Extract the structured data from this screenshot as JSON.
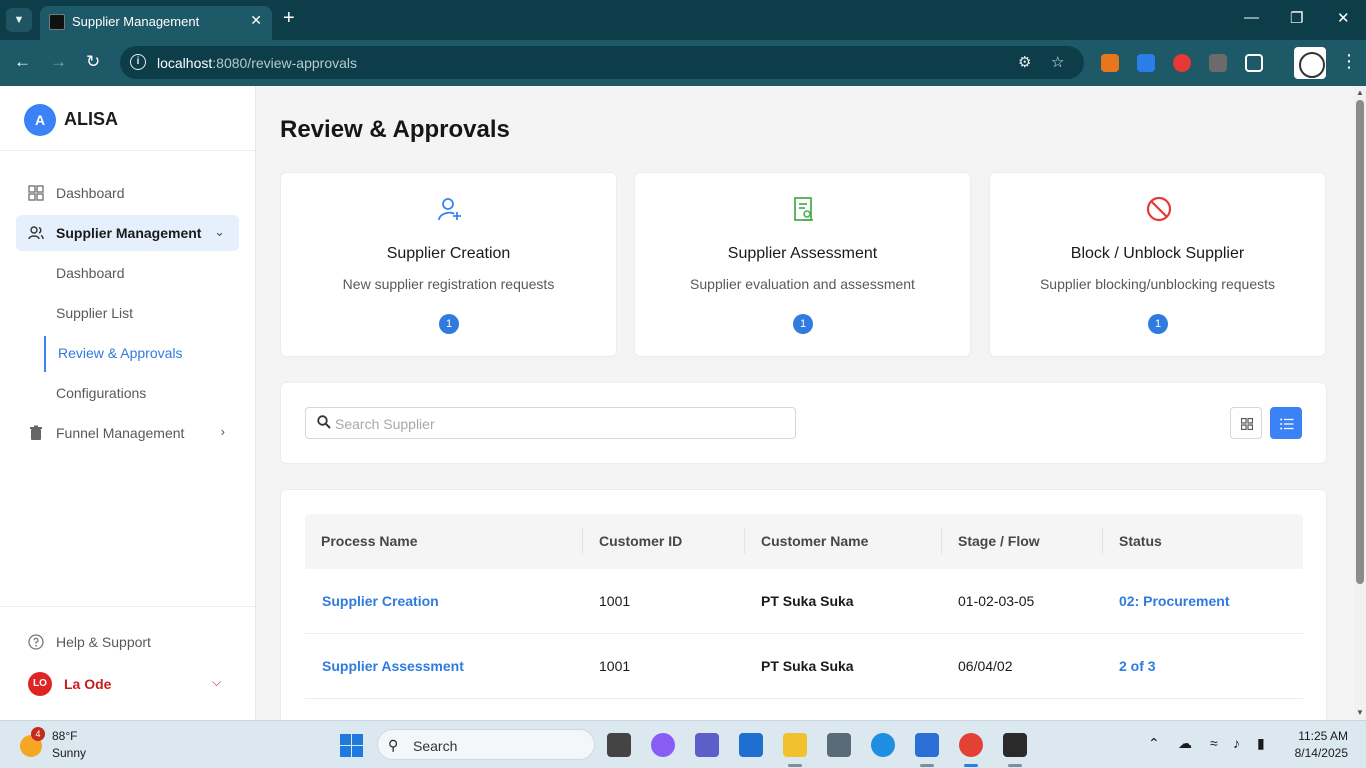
{
  "browser": {
    "tab_title": "Supplier Management",
    "url_host": "localhost",
    "url_path": ":8080/review-approvals"
  },
  "sidebar": {
    "brand_initial": "A",
    "brand_name": "ALISA",
    "items": [
      {
        "label": "Dashboard",
        "icon": "dashboard-grid-icon"
      },
      {
        "label": "Supplier Management",
        "icon": "users-icon",
        "expanded": true
      },
      {
        "label": "Funnel Management",
        "icon": "trash-icon"
      }
    ],
    "sub_items": [
      "Dashboard",
      "Supplier List",
      "Review & Approvals",
      "Configurations"
    ],
    "help_label": "Help & Support",
    "user_initials": "LO",
    "user_name": "La Ode"
  },
  "main": {
    "page_title": "Review & Approvals",
    "cards": [
      {
        "title": "Supplier Creation",
        "desc": "New supplier registration requests",
        "count": "1",
        "icon": "user-plus-icon",
        "color": "#3b82f6"
      },
      {
        "title": "Supplier Assessment",
        "desc": "Supplier evaluation and assessment",
        "count": "1",
        "icon": "document-badge-icon",
        "color": "#4caf50"
      },
      {
        "title": "Block / Unblock Supplier",
        "desc": "Supplier blocking/unblocking requests",
        "count": "1",
        "icon": "block-icon",
        "color": "#e53935"
      }
    ],
    "search_placeholder": "Search Supplier",
    "view_mode": "list",
    "table": {
      "columns": [
        "Process Name",
        "Customer ID",
        "Customer Name",
        "Stage / Flow",
        "Status"
      ],
      "rows": [
        [
          "Supplier Creation",
          "1001",
          "PT Suka Suka",
          "01-02-03-05",
          "02: Procurement"
        ],
        [
          "Supplier Assessment",
          "1001",
          "PT Suka Suka",
          "06/04/02",
          "2 of 3"
        ]
      ]
    }
  },
  "taskbar": {
    "weather_badge": "4",
    "weather_temp": "88°F",
    "weather_cond": "Sunny",
    "search_label": "Search",
    "time": "11:25 AM",
    "date": "8/14/2025"
  }
}
